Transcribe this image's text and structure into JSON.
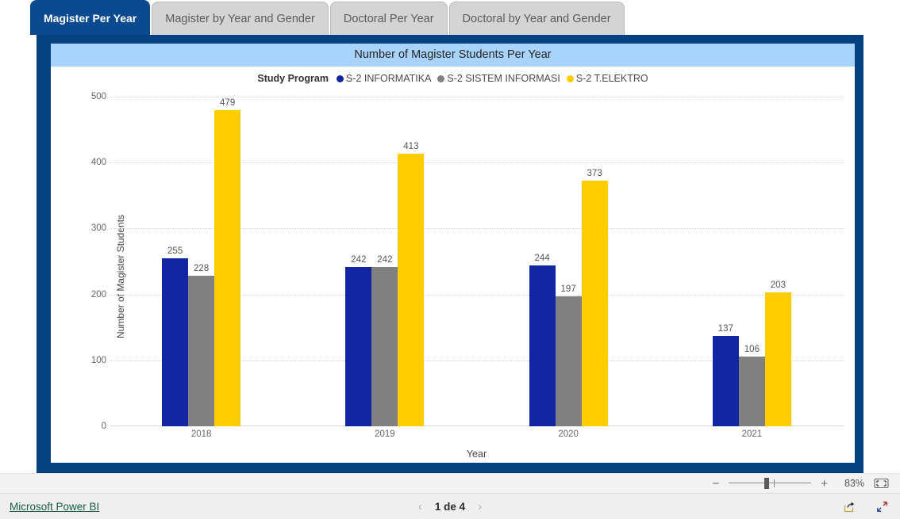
{
  "tabs": [
    {
      "label": "Magister Per Year",
      "active": true
    },
    {
      "label": "Magister by Year and Gender",
      "active": false
    },
    {
      "label": "Doctoral Per Year",
      "active": false
    },
    {
      "label": "Doctoral by Year and Gender",
      "active": false
    }
  ],
  "visual": {
    "title": "Number of Magister Students Per Year",
    "legend_title": "Study Program"
  },
  "zoombar": {
    "minus": "−",
    "plus": "+",
    "percent": "83%",
    "fit_icon": "fit-to-page-icon"
  },
  "footer": {
    "brand": "Microsoft Power BI",
    "prev_icon": "chevron-left-icon",
    "next_icon": "chevron-right-icon",
    "page_text": "1 de 4",
    "share_icon": "share-icon",
    "fullscreen_icon": "fullscreen-icon"
  },
  "colors": {
    "accent_navy": "#064182",
    "tab_active": "#0b4a8f",
    "title_band": "#a8d3fb",
    "series_informatika": "#1226A3",
    "series_sistem_informasi": "#808080",
    "series_elektro": "#FFCC00"
  },
  "chart_data": {
    "type": "bar",
    "title": "Number of Magister Students Per Year",
    "xlabel": "Year",
    "ylabel": "Number of Magister Students",
    "categories": [
      "2018",
      "2019",
      "2020",
      "2021"
    ],
    "series": [
      {
        "name": "S-2 INFORMATIKA",
        "color": "#1226A3",
        "values": [
          255,
          242,
          244,
          137
        ]
      },
      {
        "name": "S-2 SISTEM INFORMASI",
        "color": "#808080",
        "values": [
          228,
          242,
          197,
          106
        ]
      },
      {
        "name": "S-2 T.ELEKTRO",
        "color": "#FFCC00",
        "values": [
          479,
          413,
          373,
          203
        ]
      }
    ],
    "ylim": [
      0,
      500
    ],
    "yticks": [
      0,
      100,
      200,
      300,
      400,
      500
    ],
    "grid": true,
    "legend_position": "top"
  }
}
